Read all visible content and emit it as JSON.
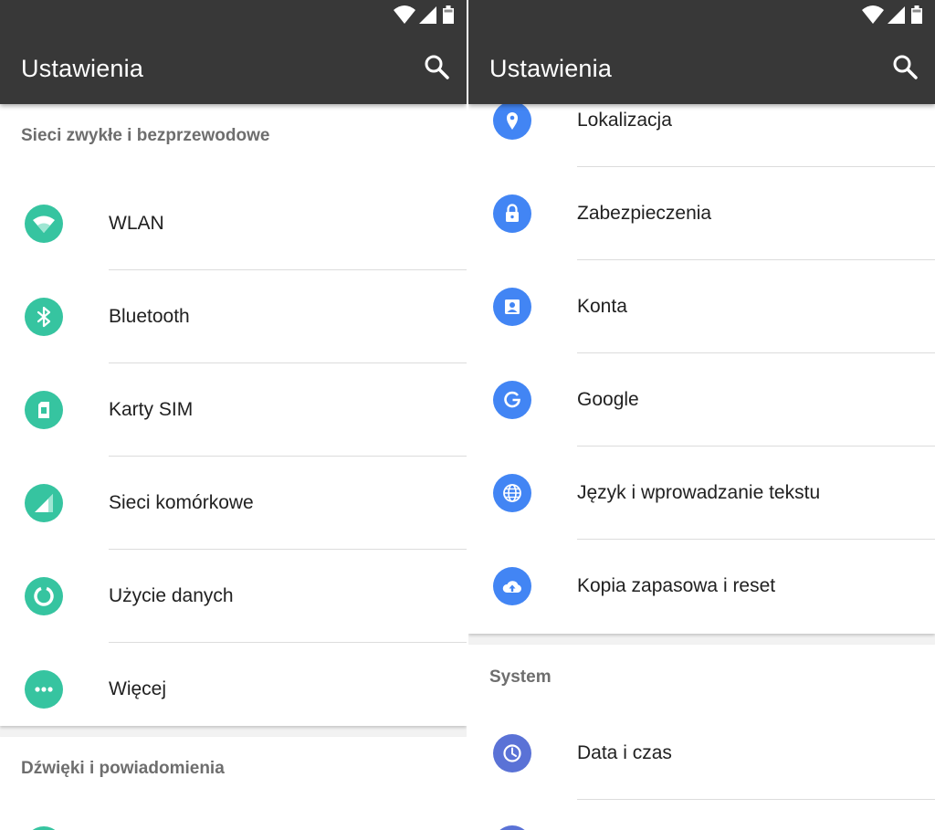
{
  "colors": {
    "app_bar": "#383838",
    "network_icon_bg": "#36c4a0",
    "personal_icon_bg": "#4285f4",
    "system_icon_bg": "#5a72d6",
    "section_header_text": "#6e6e6e",
    "item_text": "#212121"
  },
  "status_bar": {
    "icons": [
      "wifi-icon",
      "signal-icon",
      "battery-icon"
    ]
  },
  "left_panel": {
    "app_bar": {
      "title": "Ustawienia",
      "search_icon": "search-icon"
    },
    "sections": [
      {
        "header": "Sieci zwykłe i bezprzewodowe",
        "items": [
          {
            "label": "WLAN",
            "icon": "wifi-icon"
          },
          {
            "label": "Bluetooth",
            "icon": "bluetooth-icon"
          },
          {
            "label": "Karty SIM",
            "icon": "sim-card-icon"
          },
          {
            "label": "Sieci komórkowe",
            "icon": "cellular-signal-icon"
          },
          {
            "label": "Użycie danych",
            "icon": "data-usage-icon"
          },
          {
            "label": "Więcej",
            "icon": "more-icon"
          }
        ]
      },
      {
        "header": "Dźwięki i powiadomienia",
        "items": []
      }
    ]
  },
  "right_panel": {
    "app_bar": {
      "title": "Ustawienia",
      "search_icon": "search-icon"
    },
    "sections": [
      {
        "header": "",
        "items": [
          {
            "label": "Lokalizacja",
            "icon": "location-icon"
          },
          {
            "label": "Zabezpieczenia",
            "icon": "lock-icon"
          },
          {
            "label": "Konta",
            "icon": "account-icon"
          },
          {
            "label": "Google",
            "icon": "google-icon"
          },
          {
            "label": "Język i wprowadzanie tekstu",
            "icon": "globe-icon"
          },
          {
            "label": "Kopia zapasowa i reset",
            "icon": "cloud-upload-icon"
          }
        ]
      },
      {
        "header": "System",
        "items": [
          {
            "label": "Data i czas",
            "icon": "clock-icon"
          }
        ]
      }
    ]
  }
}
